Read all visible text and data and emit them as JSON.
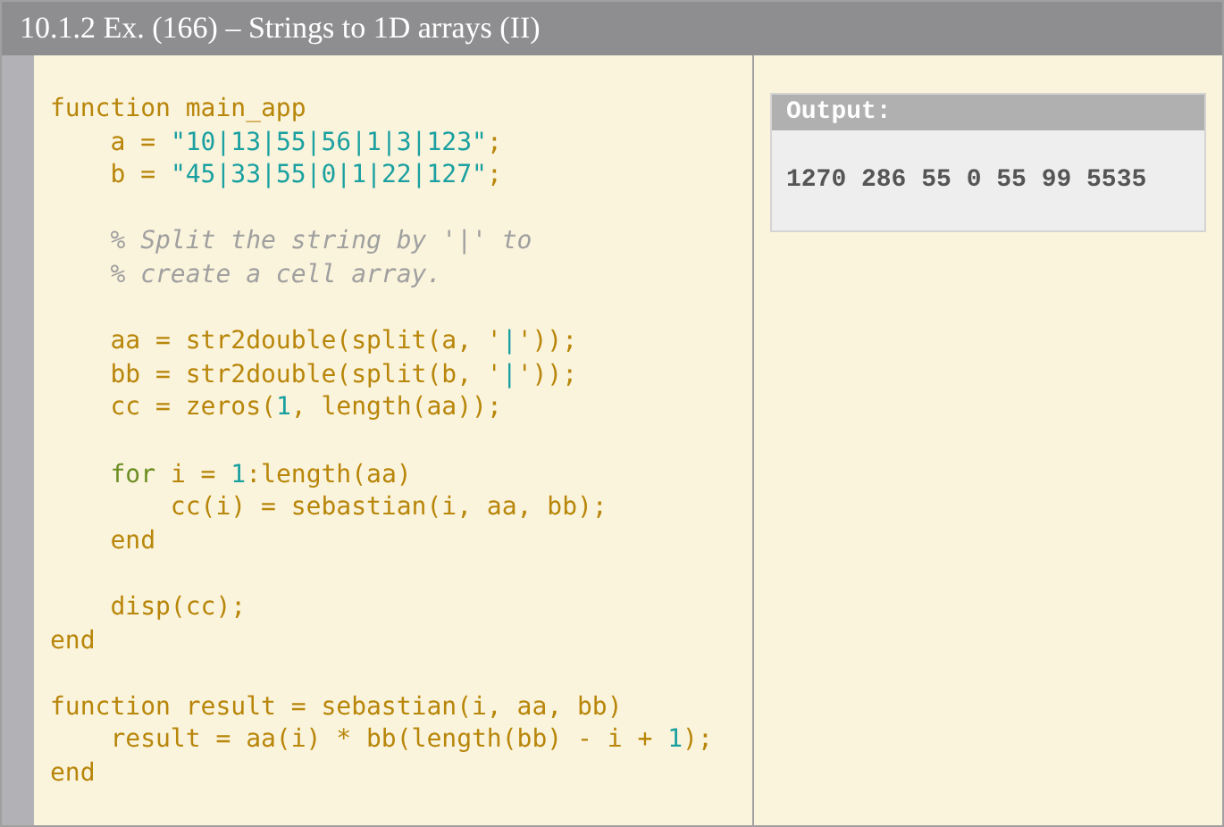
{
  "title": "10.1.2 Ex. (166) – Strings to 1D arrays (II)",
  "code": [
    {
      "kind": "code",
      "tokens": [
        {
          "kind": "plain",
          "text": "function main_app"
        }
      ]
    },
    {
      "kind": "code",
      "tokens": [
        {
          "kind": "plain",
          "text": "    a = "
        },
        {
          "kind": "string",
          "text": "\"10|13|55|56|1|3|123\""
        },
        {
          "kind": "plain",
          "text": ";"
        }
      ]
    },
    {
      "kind": "code",
      "tokens": [
        {
          "kind": "plain",
          "text": "    b = "
        },
        {
          "kind": "string",
          "text": "\"45|33|55|0|1|22|127\""
        },
        {
          "kind": "plain",
          "text": ";"
        }
      ]
    },
    {
      "kind": "blank"
    },
    {
      "kind": "code",
      "tokens": [
        {
          "kind": "comment",
          "text": "    % Split the string by '|' to"
        }
      ]
    },
    {
      "kind": "code",
      "tokens": [
        {
          "kind": "comment",
          "text": "    % create a cell array."
        }
      ]
    },
    {
      "kind": "blank"
    },
    {
      "kind": "code",
      "tokens": [
        {
          "kind": "plain",
          "text": "    aa = str2double(split(a, '"
        },
        {
          "kind": "string",
          "text": "|"
        },
        {
          "kind": "plain",
          "text": "'));"
        }
      ]
    },
    {
      "kind": "code",
      "tokens": [
        {
          "kind": "plain",
          "text": "    bb = str2double(split(b, '"
        },
        {
          "kind": "string",
          "text": "|"
        },
        {
          "kind": "plain",
          "text": "'));"
        }
      ]
    },
    {
      "kind": "code",
      "tokens": [
        {
          "kind": "plain",
          "text": "    cc = zeros("
        },
        {
          "kind": "number",
          "text": "1"
        },
        {
          "kind": "plain",
          "text": ", length(aa));"
        }
      ]
    },
    {
      "kind": "blank"
    },
    {
      "kind": "code",
      "tokens": [
        {
          "kind": "keyword",
          "text": "    for"
        },
        {
          "kind": "plain",
          "text": " i = "
        },
        {
          "kind": "number",
          "text": "1"
        },
        {
          "kind": "plain",
          "text": ":length(aa)"
        }
      ]
    },
    {
      "kind": "code",
      "tokens": [
        {
          "kind": "plain",
          "text": "        cc(i) = sebastian(i, aa, bb);"
        }
      ]
    },
    {
      "kind": "code",
      "tokens": [
        {
          "kind": "plain",
          "text": "    end"
        }
      ]
    },
    {
      "kind": "blank"
    },
    {
      "kind": "code",
      "tokens": [
        {
          "kind": "plain",
          "text": "    disp(cc);"
        }
      ]
    },
    {
      "kind": "code",
      "tokens": [
        {
          "kind": "plain",
          "text": "end"
        }
      ]
    },
    {
      "kind": "blank"
    },
    {
      "kind": "code",
      "tokens": [
        {
          "kind": "plain",
          "text": "function result = sebastian(i, aa, bb)"
        }
      ]
    },
    {
      "kind": "code",
      "tokens": [
        {
          "kind": "plain",
          "text": "    result = aa(i) * bb(length(bb) - i + "
        },
        {
          "kind": "number",
          "text": "1"
        },
        {
          "kind": "plain",
          "text": ");"
        }
      ]
    },
    {
      "kind": "code",
      "tokens": [
        {
          "kind": "plain",
          "text": "end"
        }
      ]
    }
  ],
  "output": {
    "label": "Output:",
    "text": "1270 286 55 0 55 99 5535"
  }
}
